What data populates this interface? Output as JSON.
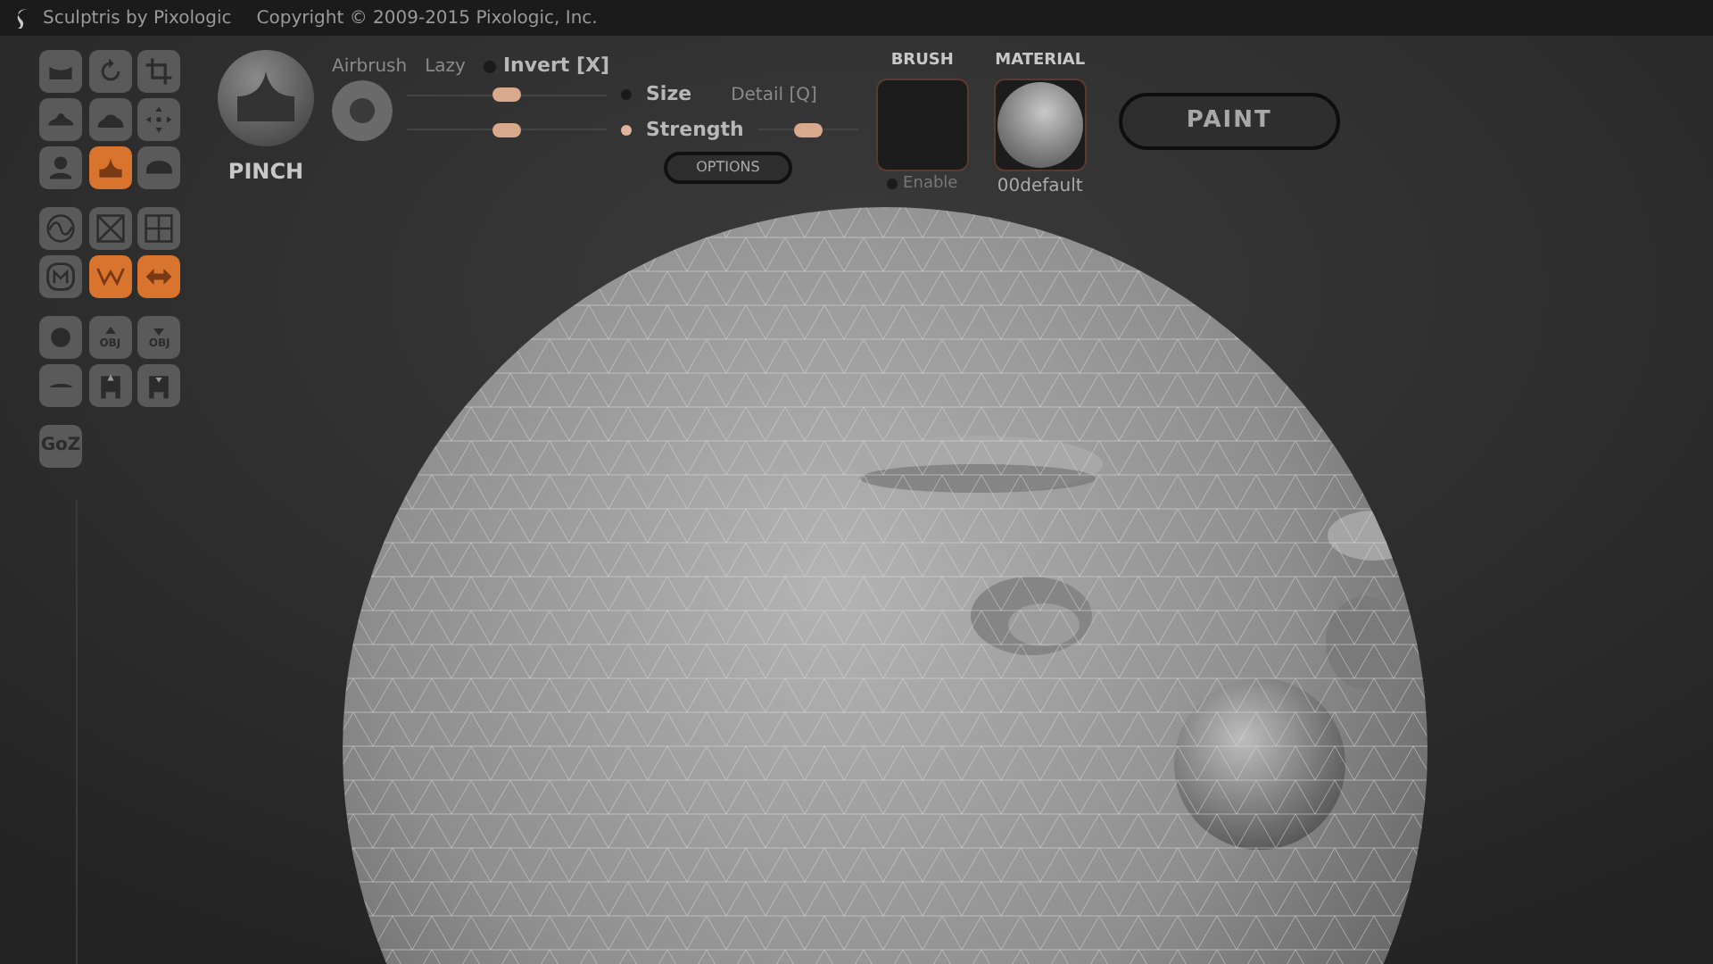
{
  "window": {
    "title": "Sculptris by Pixologic",
    "copyright": "Copyright © 2009-2015 Pixologic, Inc."
  },
  "tools": [
    [
      {
        "kind": "valley",
        "selected": false
      },
      {
        "kind": "rotate",
        "selected": false
      },
      {
        "kind": "crop",
        "selected": false
      },
      {
        "kind": "mound",
        "selected": false
      },
      {
        "kind": "dome",
        "selected": false
      },
      {
        "kind": "move",
        "selected": false
      },
      {
        "kind": "bust",
        "selected": false
      },
      {
        "kind": "peak",
        "selected": true
      },
      {
        "kind": "hill",
        "selected": false
      }
    ],
    [
      {
        "kind": "wave",
        "selected": false
      },
      {
        "kind": "cross",
        "selected": false
      },
      {
        "kind": "grid",
        "selected": false
      },
      {
        "kind": "m-circle",
        "selected": false
      },
      {
        "kind": "zigzag",
        "selected": true
      },
      {
        "kind": "double-arrow",
        "selected": true
      }
    ],
    [
      {
        "kind": "ball",
        "selected": false
      },
      {
        "kind": "obj-up",
        "selected": false,
        "label": "OBJ"
      },
      {
        "kind": "obj-down",
        "selected": false,
        "label": "OBJ"
      },
      {
        "kind": "flat",
        "selected": false
      },
      {
        "kind": "save-up",
        "selected": false
      },
      {
        "kind": "save-down",
        "selected": false
      }
    ],
    [
      {
        "kind": "text",
        "selected": false,
        "label": "GoZ"
      }
    ]
  ],
  "brush": {
    "name": "PINCH",
    "airbrush": "Airbrush",
    "lazy": "Lazy",
    "invert": {
      "label": "Invert [X]",
      "on": false
    },
    "size": {
      "label": "Size",
      "on": false,
      "level": 0.5
    },
    "strength": {
      "label": "Strength",
      "on": true,
      "level": 0.5
    },
    "detail": {
      "label": "Detail [Q]",
      "level": 0.5
    },
    "options": "OPTIONS"
  },
  "brush_slot": {
    "title": "BRUSH",
    "enable": {
      "label": "Enable",
      "on": false
    }
  },
  "material": {
    "title": "MATERIAL",
    "name": "00default"
  },
  "paint_button": "PAINT"
}
